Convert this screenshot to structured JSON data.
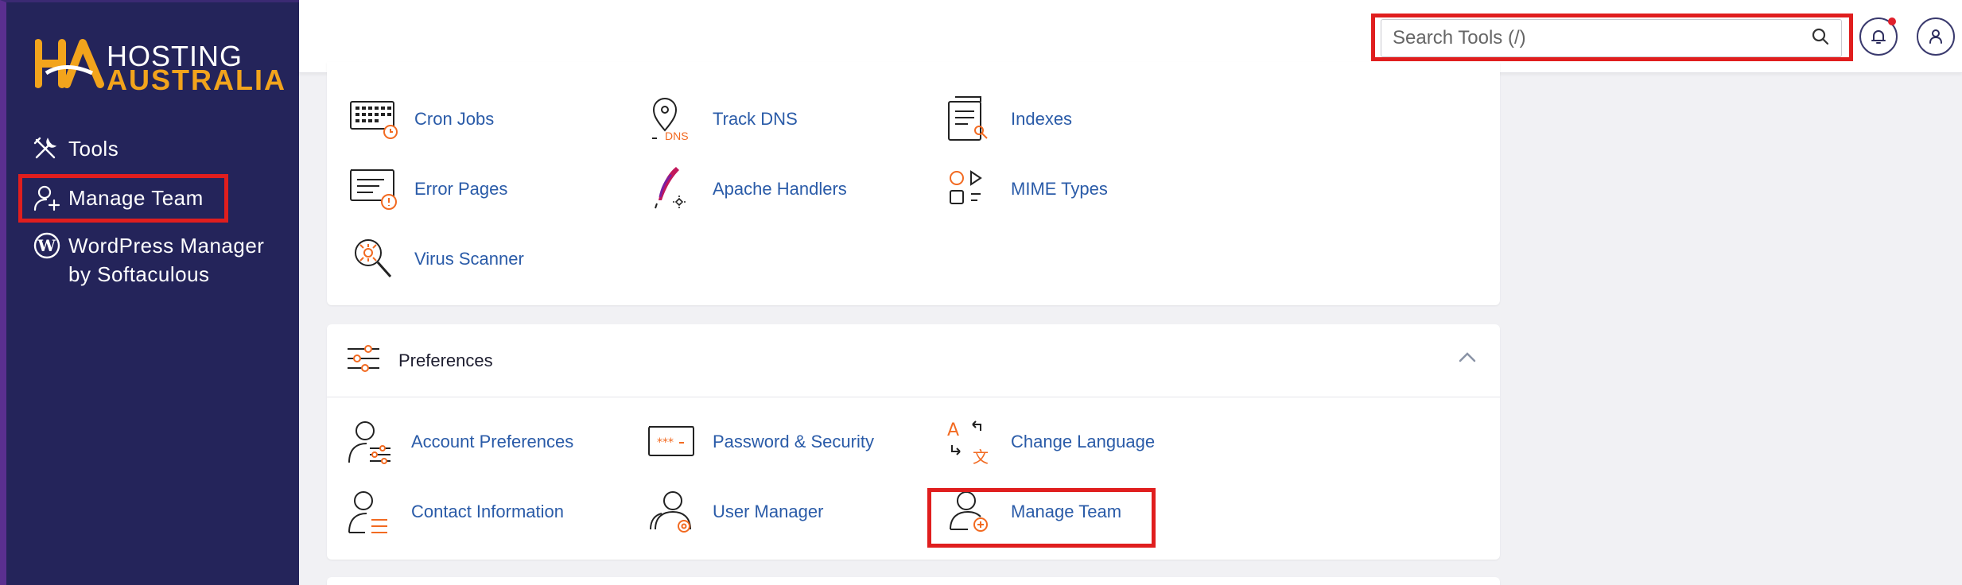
{
  "brand": {
    "line1": "HOSTING",
    "line2": "AUSTRALIA",
    "colors": {
      "sidebar": "#24245a",
      "accent": "#f2a41c",
      "link": "#2a5ba8",
      "highlight": "#e01e1e"
    }
  },
  "sidebar": {
    "items": [
      {
        "label": "Tools",
        "icon": "tools-icon"
      },
      {
        "label": "Manage Team",
        "icon": "manage-team-icon"
      },
      {
        "label": "WordPress Manager by Softaculous",
        "icon": "wordpress-icon"
      }
    ]
  },
  "header": {
    "search_placeholder": "Search Tools (/)"
  },
  "advanced": {
    "tools": [
      {
        "label": "Cron Jobs",
        "icon": "cron-jobs-icon"
      },
      {
        "label": "Track DNS",
        "icon": "track-dns-icon"
      },
      {
        "label": "Indexes",
        "icon": "indexes-icon"
      },
      {
        "label": "Error Pages",
        "icon": "error-pages-icon"
      },
      {
        "label": "Apache Handlers",
        "icon": "apache-handlers-icon"
      },
      {
        "label": "MIME Types",
        "icon": "mime-types-icon"
      },
      {
        "label": "Virus Scanner",
        "icon": "virus-scanner-icon"
      }
    ],
    "dns_badge": "DNS"
  },
  "preferences": {
    "title": "Preferences",
    "tools": [
      {
        "label": "Account Preferences",
        "icon": "account-preferences-icon"
      },
      {
        "label": "Password & Security",
        "icon": "password-security-icon"
      },
      {
        "label": "Change Language",
        "icon": "change-language-icon"
      },
      {
        "label": "Contact Information",
        "icon": "contact-information-icon"
      },
      {
        "label": "User Manager",
        "icon": "user-manager-icon"
      },
      {
        "label": "Manage Team",
        "icon": "manage-team-icon"
      }
    ]
  }
}
